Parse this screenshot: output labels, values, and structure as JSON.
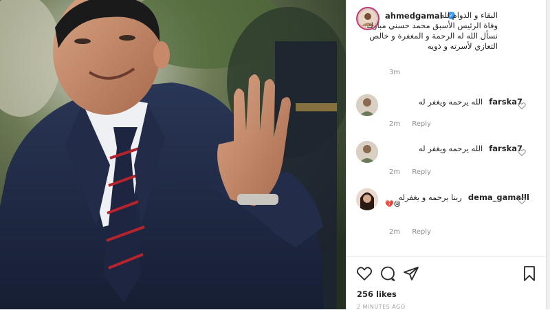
{
  "post": {
    "username": "ahmedgamal",
    "verified_mark": "✓",
    "caption_lines": [
      "البقاء و الدوام لله",
      "وفاة الرئيس الأسبق محمد حسني مبارك",
      "نسأل الله له الرحمة و المغفرة و خالص",
      "التعازي لأسرته و ذويه"
    ],
    "time": "3m"
  },
  "comments": [
    {
      "username": "farska7",
      "text": "الله يرحمه ويغفر له",
      "time": "2m",
      "reply": "Reply",
      "avatar_icon": "user-avatar-icon"
    },
    {
      "username": "farska7",
      "text": "الله يرحمه ويغفر له",
      "time": "2m",
      "reply": "Reply",
      "avatar_icon": "user-avatar-icon"
    },
    {
      "username": "dema_gamalll",
      "text": "ربنا يرحمه و يغفرله",
      "emoji": "💔😢",
      "time": "2m",
      "reply": "Reply",
      "avatar_icon": "user-avatar-icon"
    }
  ],
  "actions": {
    "likes": "256 likes",
    "timestamp": "2 MINUTES AGO",
    "icons": [
      "heart-icon",
      "comment-icon",
      "share-icon",
      "bookmark-icon"
    ]
  },
  "colors": {
    "verified": "#3897f0",
    "story_ring": "#c6387a",
    "meta_gray": "#8e8e8e",
    "suit": "#1f2a44",
    "tie_red": "#b5232d"
  }
}
